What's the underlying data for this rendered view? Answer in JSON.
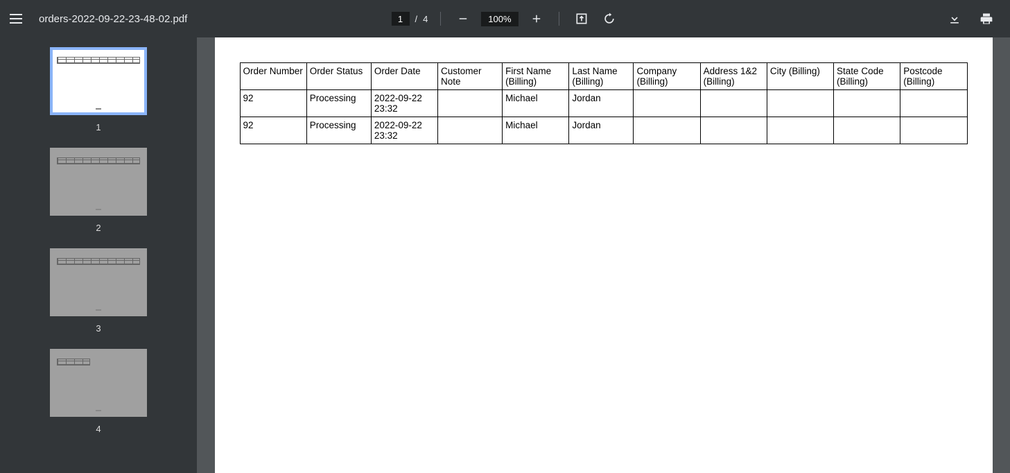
{
  "toolbar": {
    "filename": "orders-2022-09-22-23-48-02.pdf",
    "current_page": "1",
    "page_sep": "/",
    "total_pages": "4",
    "zoom": "100%"
  },
  "sidebar": {
    "thumbs": [
      {
        "num": "1",
        "selected": true,
        "small": false
      },
      {
        "num": "2",
        "selected": false,
        "small": false
      },
      {
        "num": "3",
        "selected": false,
        "small": false
      },
      {
        "num": "4",
        "selected": false,
        "small": true
      }
    ]
  },
  "document": {
    "headers": [
      "Order Number",
      "Order Status",
      "Order Date",
      "Customer Note",
      "First Name (Billing)",
      "Last Name (Billing)",
      "Company (Billing)",
      "Address 1&2 (Billing)",
      "City (Billing)",
      "State Code (Billing)",
      "Postcode (Billing)"
    ],
    "rows": [
      {
        "tall": true,
        "cells": [
          "92",
          "Processing",
          "2022-09-22 23:32",
          "",
          "Michael",
          "Jordan",
          "",
          "",
          "",
          "",
          ""
        ]
      },
      {
        "tall": false,
        "cells": [
          "92",
          "Processing",
          "2022-09-22 23:32",
          "",
          "Michael",
          "Jordan",
          "",
          "",
          "",
          "",
          ""
        ]
      }
    ]
  }
}
